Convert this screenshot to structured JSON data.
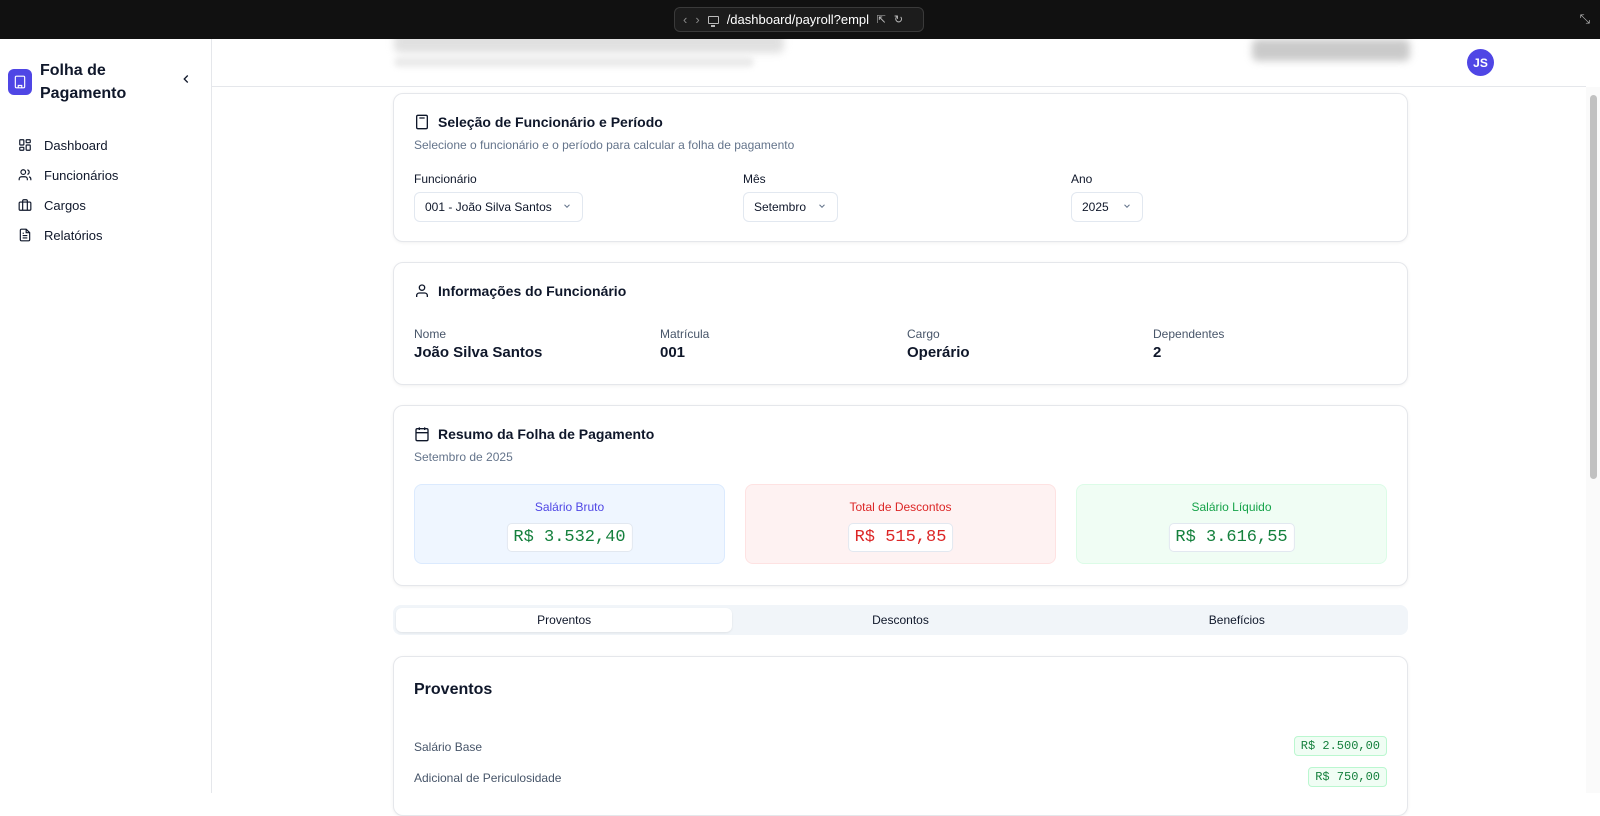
{
  "browser": {
    "url": "/dashboard/payroll?emplo"
  },
  "sidebar": {
    "brand_title": "Folha de Pagamento",
    "items": [
      {
        "label": "Dashboard",
        "icon": "dashboard-icon"
      },
      {
        "label": "Funcionários",
        "icon": "users-icon"
      },
      {
        "label": "Cargos",
        "icon": "briefcase-icon"
      },
      {
        "label": "Relatórios",
        "icon": "file-text-icon"
      }
    ]
  },
  "header": {
    "avatar_initials": "JS"
  },
  "selection": {
    "title": "Seleção de Funcionário e Período",
    "description": "Selecione o funcionário e o período para calcular a folha de pagamento",
    "employee_label": "Funcionário",
    "employee_value": "001 - João Silva Santos",
    "month_label": "Mês",
    "month_value": "Setembro",
    "year_label": "Ano",
    "year_value": "2025"
  },
  "employee_info": {
    "title": "Informações do Funcionário",
    "fields": [
      {
        "label": "Nome",
        "value": "João Silva Santos"
      },
      {
        "label": "Matrícula",
        "value": "001"
      },
      {
        "label": "Cargo",
        "value": "Operário"
      },
      {
        "label": "Dependentes",
        "value": "2"
      }
    ]
  },
  "summary": {
    "title": "Resumo da Folha de Pagamento",
    "period": "Setembro de 2025",
    "gross_label": "Salário Bruto",
    "gross_value": "R$ 3.532,40",
    "deductions_label": "Total de Descontos",
    "deductions_value": "R$ 515,85",
    "net_label": "Salário Líquido",
    "net_value": "R$ 3.616,55"
  },
  "tabs": [
    "Proventos",
    "Descontos",
    "Benefícios"
  ],
  "earnings": {
    "title": "Proventos",
    "rows": [
      {
        "label": "Salário Base",
        "value": "R$ 2.500,00"
      },
      {
        "label": "Adicional de Periculosidade",
        "value": "R$ 750,00"
      }
    ]
  },
  "colors": {
    "accent": "#4f46e5",
    "gross_bg": "#eff6ff",
    "gross_text": "#4f46e5",
    "deductions_bg": "#fef2f2",
    "deductions_text": "#dc2626",
    "net_bg": "#f0fdf4",
    "net_text": "#16a34a"
  }
}
